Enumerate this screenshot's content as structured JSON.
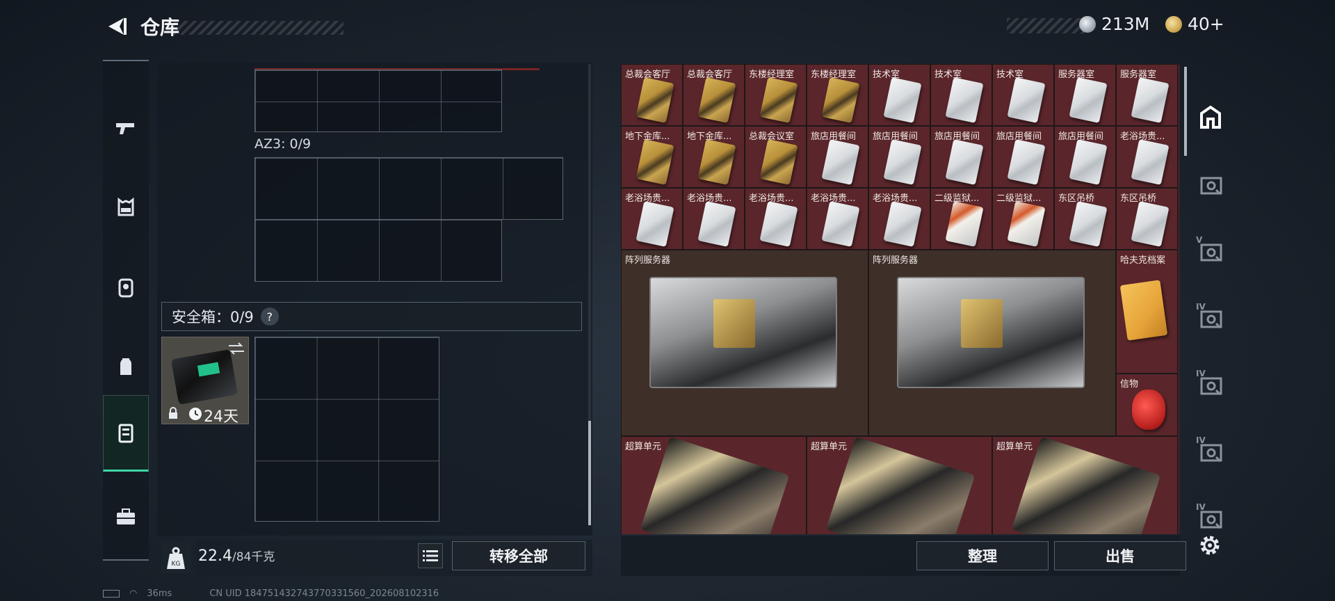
{
  "header": {
    "title": "仓库",
    "currencies": [
      {
        "icon": "silver-coin-icon",
        "value": "213M"
      },
      {
        "icon": "gold-coin-icon",
        "value": "40+"
      }
    ]
  },
  "left_nav": {
    "items": [
      {
        "name": "weapon-icon"
      },
      {
        "name": "vest-icon"
      },
      {
        "name": "armor-icon"
      },
      {
        "name": "backpack-icon"
      },
      {
        "name": "safe-case-icon",
        "active": true
      },
      {
        "name": "toolbox-icon"
      }
    ]
  },
  "inventory": {
    "az3_label": "AZ3: 0/9",
    "safe_label": "安全箱：0/9",
    "safe_help": "?",
    "safe_days": "24天",
    "weight_value": "22.4",
    "weight_max": "/84千克",
    "transfer_all": "转移全部"
  },
  "stash": {
    "rows": [
      [
        "总裁会客厅",
        "总裁会客厅",
        "东楼经理室",
        "东楼经理室",
        "技术室",
        "技术室",
        "技术室",
        "服务器室",
        "服务器室"
      ],
      [
        "地下金库...",
        "地下金库...",
        "总裁会议室",
        "旅店用餐间",
        "旅店用餐间",
        "旅店用餐间",
        "旅店用餐间",
        "旅店用餐间",
        "老浴场贵..."
      ],
      [
        "老浴场贵...",
        "老浴场贵...",
        "老浴场贵...",
        "老浴场贵...",
        "老浴场贵...",
        "二级监狱...",
        "二级监狱...",
        "东区吊桥",
        "东区吊桥"
      ]
    ],
    "card_types": [
      [
        "gold",
        "gold",
        "gold",
        "gold",
        "white",
        "white",
        "white",
        "white",
        "white"
      ],
      [
        "gold",
        "gold",
        "gold",
        "white",
        "white",
        "white",
        "white",
        "white",
        "white"
      ],
      [
        "white",
        "white",
        "white",
        "white",
        "white",
        "orange",
        "orange",
        "white",
        "white"
      ]
    ],
    "server_label": "阵列服务器",
    "dossier_label": "哈夫克档案",
    "token_label": "信物",
    "compute_label": "超算单元",
    "sort_button": "整理",
    "sell_button": "出售"
  },
  "right_nav": {
    "items": [
      {
        "name": "stash-main-icon",
        "tier": ""
      },
      {
        "name": "stash-tier-1-icon",
        "tier": ""
      },
      {
        "name": "stash-tier-v-icon",
        "tier": "V"
      },
      {
        "name": "stash-tier-iv-icon",
        "tier": "IV"
      },
      {
        "name": "stash-tier-iv-icon",
        "tier": "IV"
      },
      {
        "name": "stash-tier-iv-icon",
        "tier": "IV"
      },
      {
        "name": "stash-tier-iv-icon",
        "tier": "IV"
      }
    ]
  },
  "status_bar": {
    "ping": "36ms",
    "uid": "CN UID 184751432743770331560_202608102316"
  },
  "colors": {
    "accent": "#3fd6a8",
    "stash_cell": "#5a262b",
    "panel": "#141b22"
  }
}
